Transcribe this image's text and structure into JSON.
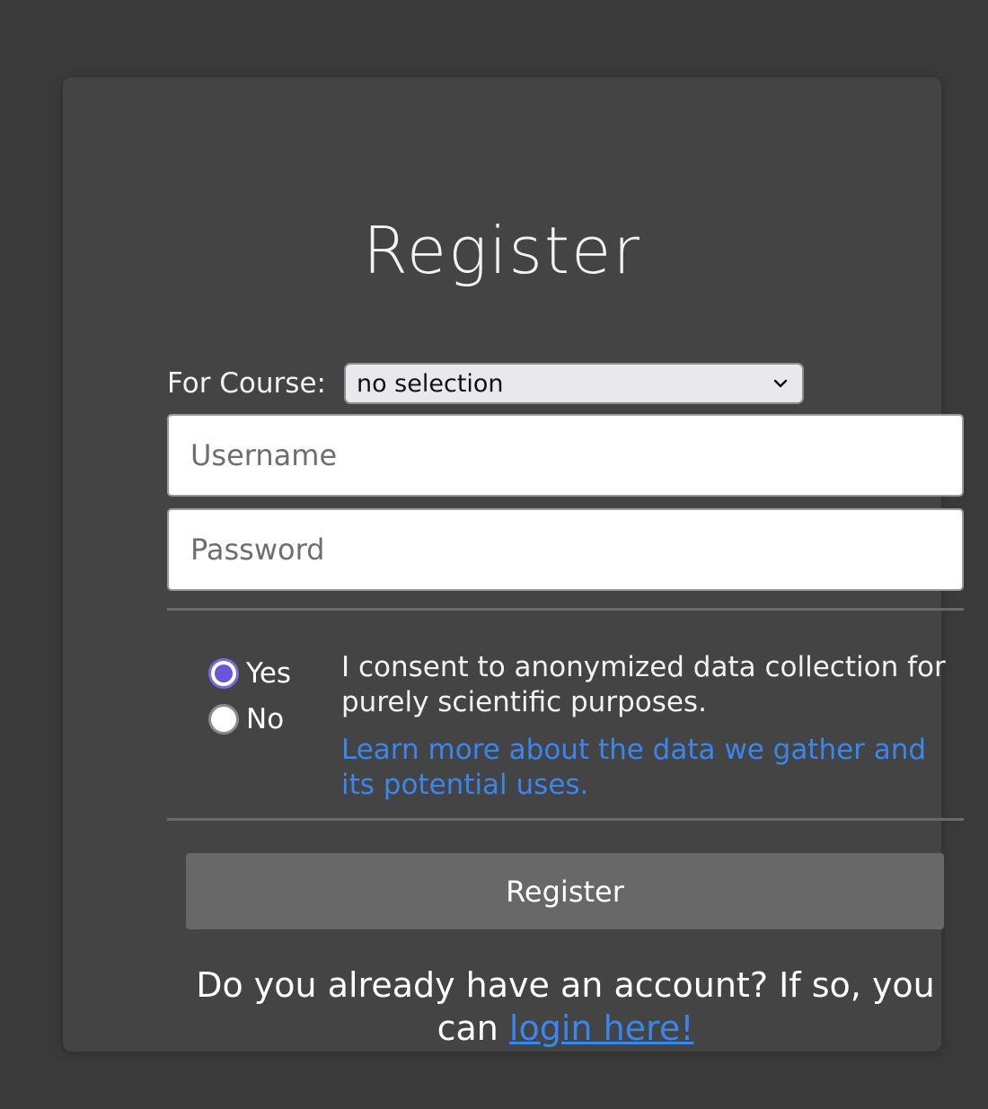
{
  "page": {
    "title": "Register"
  },
  "course": {
    "label": "For Course:",
    "selected": "no selection",
    "icon": "chevron-down-icon"
  },
  "username": {
    "placeholder": "Username",
    "value": ""
  },
  "password": {
    "placeholder": "Password",
    "value": ""
  },
  "consent": {
    "options": [
      {
        "label": "Yes",
        "checked": true
      },
      {
        "label": "No",
        "checked": false
      }
    ],
    "text": "I consent to anonymized data collection for purely scientific purposes.",
    "link_text": "Learn more about the data we gather and its potential uses."
  },
  "register_button": {
    "label": "Register"
  },
  "login_prompt": {
    "text": "Do you already have an account? If so, you can",
    "link_text": "login here!"
  },
  "colors": {
    "background": "#3a3a3a",
    "card": "#444444",
    "link": "#3a86f0",
    "radio_accent": "#6a55d8",
    "button": "#686868"
  }
}
